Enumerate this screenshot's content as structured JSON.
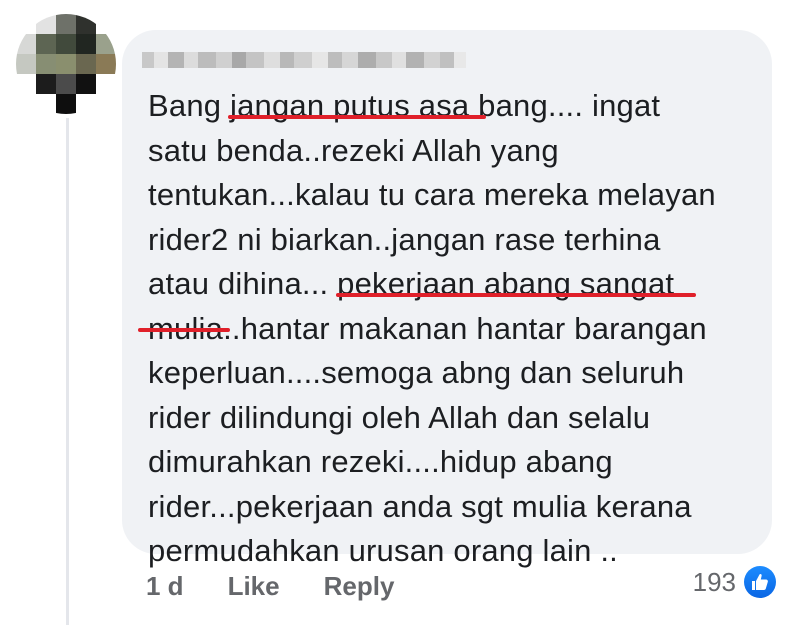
{
  "comment": {
    "lines": [
      "Bang jangan putus asa bang.... ingat",
      "satu benda..rezeki Allah yang",
      "tentukan...kalau tu cara mereka melayan",
      "rider2 ni biarkan..jangan rase terhina",
      "atau dihina... pekerjaan abang sangat",
      "mulia..hantar makanan hantar barangan",
      "keperluan....semoga abng dan seluruh",
      "rider dilindungi oleh Allah dan selalu",
      "dimurahkan rezeki....hidup abang",
      "rider...pekerjaan anda sgt mulia kerana",
      "permudahkan urusan orang lain .."
    ],
    "highlights": [
      "jangan putus asa",
      "pekerjaan abang sangat",
      "mulia"
    ]
  },
  "actions": {
    "time": "1 d",
    "like_label": "Like",
    "reply_label": "Reply"
  },
  "reactions": {
    "count": "193",
    "icon": "thumbs-up-icon"
  },
  "colors": {
    "bubble": "#f0f2f5",
    "text": "#1c1e21",
    "meta": "#65676b",
    "highlight_underline": "#e0202a",
    "like_blue": "#1877f2"
  }
}
